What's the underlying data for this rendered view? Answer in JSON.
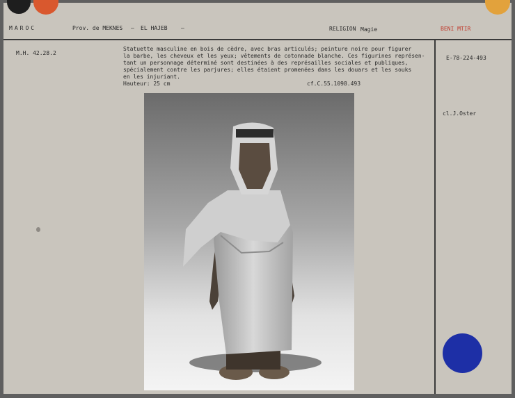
{
  "header": {
    "country": "MAROC",
    "province": "Prov. de MEKNES",
    "dash1": "–",
    "region": "EL HAJEB",
    "dash2": "–",
    "religion_label": "RELIGION",
    "religion_value": "Magie",
    "tribe": "BENI MTIR"
  },
  "left_column": {
    "inventory": "M.H. 42.28.2"
  },
  "description": {
    "lines": [
      "Statuette masculine en bois de cèdre, avec bras articulés; peinture noire pour figurer",
      "la barbe, les cheveux et les yeux; vêtements de cotonnade blanche. Ces figurines représen-",
      "tant un personnage déterminé sont destinées à des représailles sociales et publiques,",
      "spécialement contre les parjures; elles étaient promenées dans les douars et les souks",
      "en les injuriant."
    ],
    "height": "Hauteur: 25 cm",
    "crossref": "cf.C.55.1098.493"
  },
  "right_column": {
    "negative": "E-78-224-493",
    "photographer": "cl.J.Oster"
  },
  "colors": {
    "card": "#c9c5bd",
    "dot_black": "#1e1e1e",
    "dot_red": "#d9582e",
    "dot_orange": "#e2a23c",
    "dot_blue": "#1d2fa6",
    "tribe_red": "#c0392b"
  }
}
